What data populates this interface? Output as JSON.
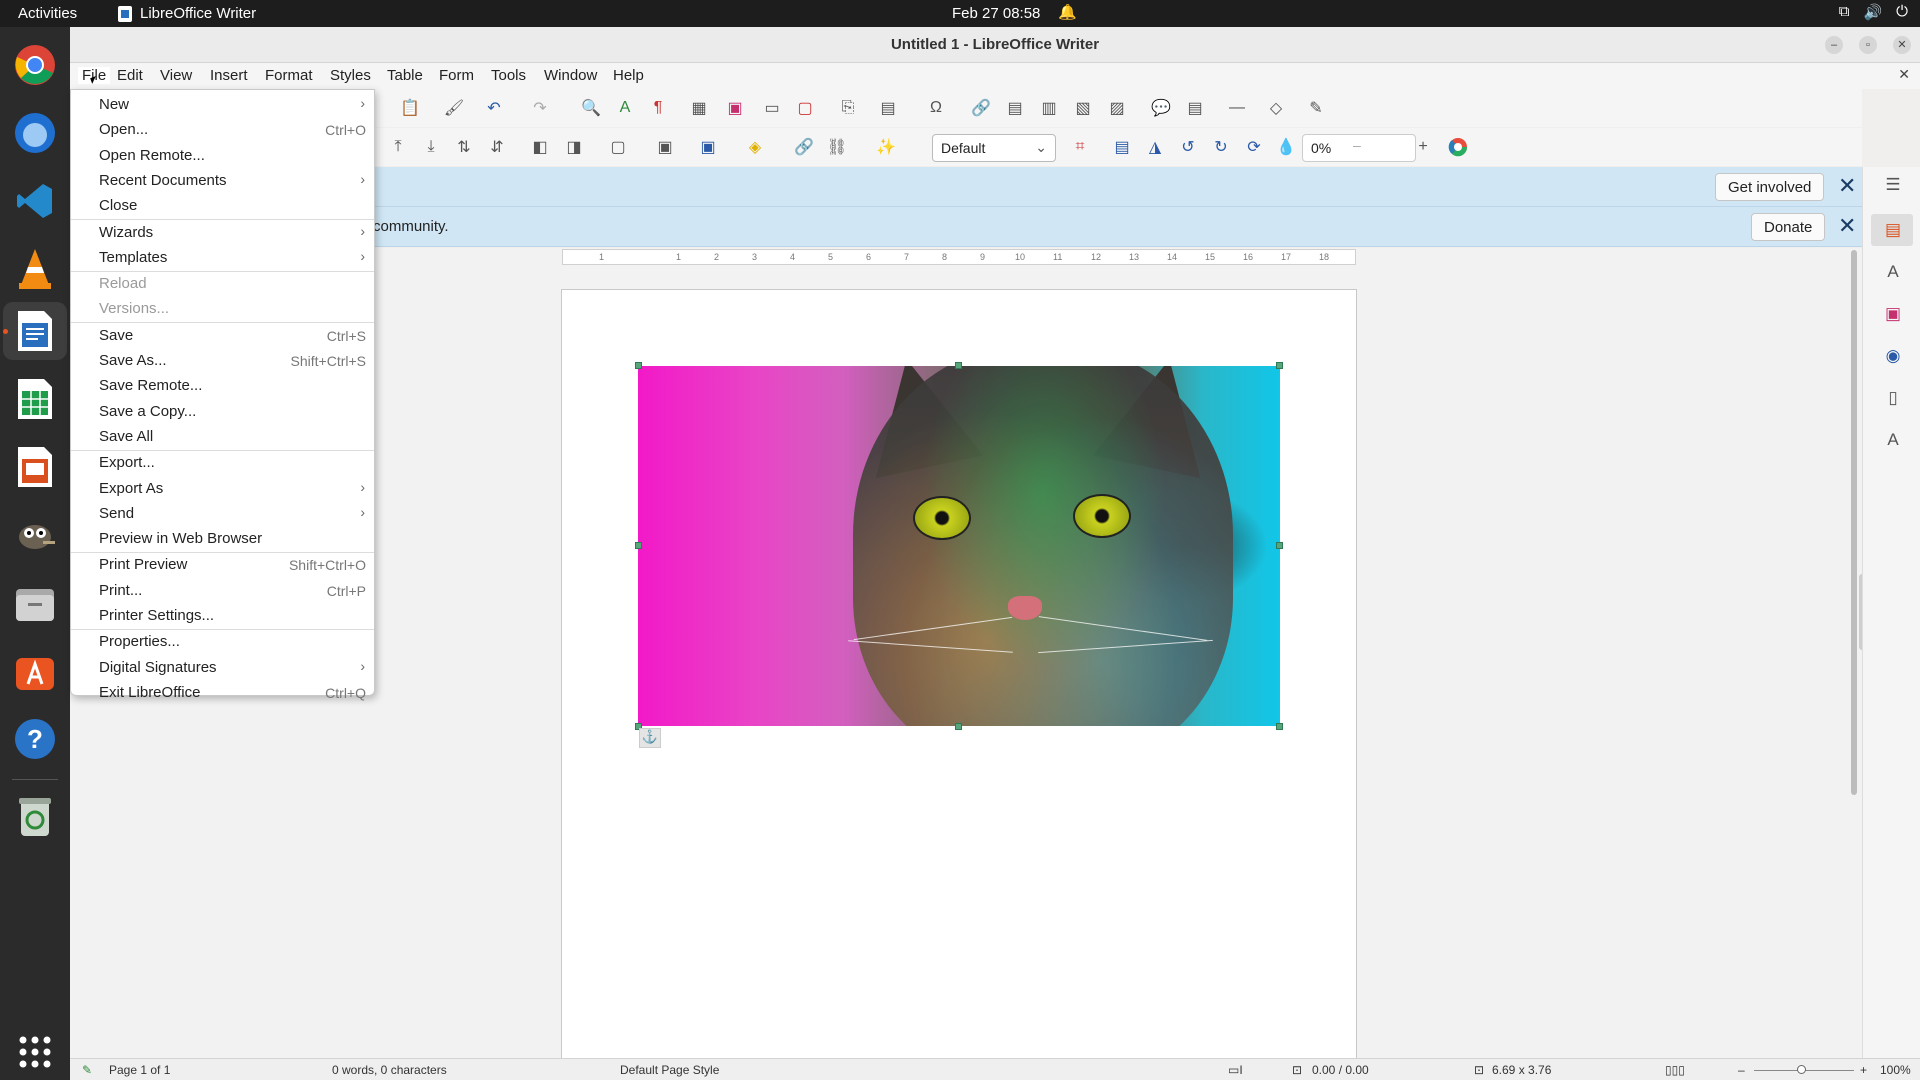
{
  "topbar": {
    "activities": "Activities",
    "app_name": "LibreOffice Writer",
    "clock": "Feb 27  08:58"
  },
  "window": {
    "title": "Untitled 1 - LibreOffice Writer"
  },
  "menubar": {
    "items": [
      "File",
      "Edit",
      "View",
      "Insert",
      "Format",
      "Styles",
      "Table",
      "Form",
      "Tools",
      "Window",
      "Help"
    ]
  },
  "toolbar": {
    "frame_style": "Default",
    "transparency": "0%"
  },
  "infobars": {
    "get_involved_button": "Get involved",
    "donate_text": "community.",
    "donate_button": "Donate"
  },
  "ruler": {
    "ticks": [
      "1",
      "1",
      "2",
      "3",
      "4",
      "5",
      "6",
      "7",
      "8",
      "9",
      "10",
      "11",
      "12",
      "13",
      "14",
      "15",
      "16",
      "17",
      "18"
    ]
  },
  "file_menu": {
    "items": [
      {
        "label": "New",
        "shortcut": "",
        "submenu": true,
        "disabled": false
      },
      {
        "label": "Open...",
        "shortcut": "Ctrl+O",
        "submenu": false,
        "disabled": false
      },
      {
        "label": "Open Remote...",
        "shortcut": "",
        "submenu": false,
        "disabled": false
      },
      {
        "label": "Recent Documents",
        "shortcut": "",
        "submenu": true,
        "disabled": false
      },
      {
        "label": "Close",
        "shortcut": "",
        "submenu": false,
        "disabled": false
      },
      {
        "label": "Wizards",
        "shortcut": "",
        "submenu": true,
        "disabled": false
      },
      {
        "label": "Templates",
        "shortcut": "",
        "submenu": true,
        "disabled": false
      },
      {
        "label": "Reload",
        "shortcut": "",
        "submenu": false,
        "disabled": true
      },
      {
        "label": "Versions...",
        "shortcut": "",
        "submenu": false,
        "disabled": true
      },
      {
        "label": "Save",
        "shortcut": "Ctrl+S",
        "submenu": false,
        "disabled": false
      },
      {
        "label": "Save As...",
        "shortcut": "Shift+Ctrl+S",
        "submenu": false,
        "disabled": false
      },
      {
        "label": "Save Remote...",
        "shortcut": "",
        "submenu": false,
        "disabled": false
      },
      {
        "label": "Save a Copy...",
        "shortcut": "",
        "submenu": false,
        "disabled": false
      },
      {
        "label": "Save All",
        "shortcut": "",
        "submenu": false,
        "disabled": false
      },
      {
        "label": "Export...",
        "shortcut": "",
        "submenu": false,
        "disabled": false
      },
      {
        "label": "Export As",
        "shortcut": "",
        "submenu": true,
        "disabled": false
      },
      {
        "label": "Send",
        "shortcut": "",
        "submenu": true,
        "disabled": false
      },
      {
        "label": "Preview in Web Browser",
        "shortcut": "",
        "submenu": false,
        "disabled": false
      },
      {
        "label": "Print Preview",
        "shortcut": "Shift+Ctrl+O",
        "submenu": false,
        "disabled": false
      },
      {
        "label": "Print...",
        "shortcut": "Ctrl+P",
        "submenu": false,
        "disabled": false
      },
      {
        "label": "Printer Settings...",
        "shortcut": "",
        "submenu": false,
        "disabled": false
      },
      {
        "label": "Properties...",
        "shortcut": "",
        "submenu": false,
        "disabled": false
      },
      {
        "label": "Digital Signatures",
        "shortcut": "",
        "submenu": true,
        "disabled": false
      },
      {
        "label": "Exit LibreOffice",
        "shortcut": "Ctrl+Q",
        "submenu": false,
        "disabled": false
      }
    ]
  },
  "statusbar": {
    "page": "Page 1 of 1",
    "words": "0 words, 0 characters",
    "page_style": "Default Page Style",
    "position": "0.00 / 0.00",
    "size": "6.69 x 3.76",
    "zoom": "100%"
  },
  "colors": {
    "infobar_bg": "#d0e6f5",
    "accent": "#e95420",
    "selection_handle": "#57a57b"
  }
}
